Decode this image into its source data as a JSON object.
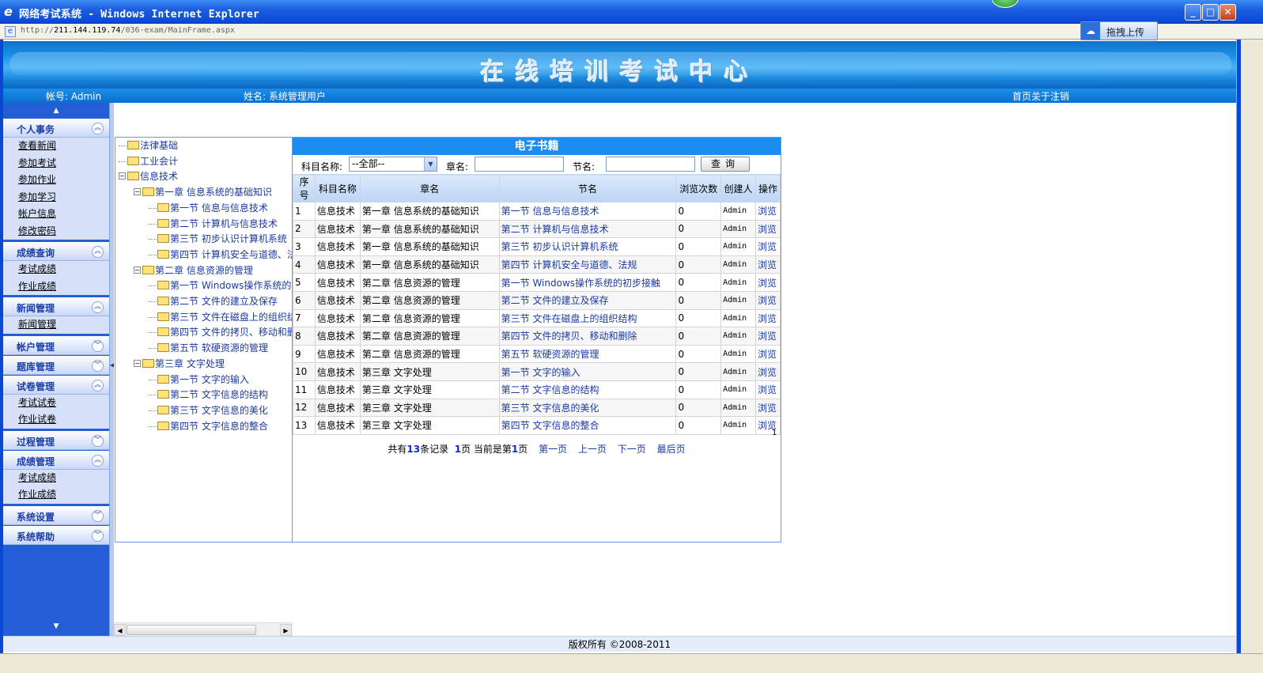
{
  "window": {
    "title": "网络考试系统 - Windows Internet Explorer",
    "url_prefix": "http://",
    "url_host": "211.144.119.74",
    "url_path": "/036-exam/MainFrame.aspx",
    "upload_button": "拖拽上传"
  },
  "header": {
    "site_title": "在线培训考试中心",
    "account": "帐号: Admin",
    "name": "姓名: 系统管理用户",
    "links": [
      "首页",
      "关于",
      "注销"
    ]
  },
  "sidebar": {
    "groups": [
      {
        "label": "个人事务",
        "expanded": true,
        "items": [
          "查看新闻",
          "参加考试",
          "参加作业",
          "参加学习",
          "帐户信息",
          "修改密码"
        ]
      },
      {
        "label": "成绩查询",
        "expanded": true,
        "items": [
          "考试成绩",
          "作业成绩"
        ]
      },
      {
        "label": "新闻管理",
        "expanded": true,
        "items": [
          "新闻管理"
        ]
      },
      {
        "label": "帐户管理",
        "expanded": false,
        "items": []
      },
      {
        "label": "题库管理",
        "expanded": false,
        "items": []
      },
      {
        "label": "试卷管理",
        "expanded": true,
        "items": [
          "考试试卷",
          "作业试卷"
        ]
      },
      {
        "label": "过程管理",
        "expanded": false,
        "items": []
      },
      {
        "label": "成绩管理",
        "expanded": true,
        "items": [
          "考试成绩",
          "作业成绩"
        ]
      },
      {
        "label": "系统设置",
        "expanded": false,
        "items": []
      },
      {
        "label": "系统帮助",
        "expanded": false,
        "items": []
      }
    ]
  },
  "tree": {
    "nodes": [
      {
        "label": "法律基础",
        "level": 0,
        "expanded": false
      },
      {
        "label": "工业会计",
        "level": 0,
        "expanded": false
      },
      {
        "label": "信息技术",
        "level": 0,
        "expanded": true
      },
      {
        "label": "第一章 信息系统的基础知识",
        "level": 1,
        "expanded": true
      },
      {
        "label": "第一节 信息与信息技术",
        "level": 2
      },
      {
        "label": "第二节 计算机与信息技术",
        "level": 2
      },
      {
        "label": "第三节 初步认识计算机系统",
        "level": 2
      },
      {
        "label": "第四节 计算机安全与道德、法规",
        "level": 2
      },
      {
        "label": "第二章 信息资源的管理",
        "level": 1,
        "expanded": true
      },
      {
        "label": "第一节 Windows操作系统的初步接触",
        "level": 2
      },
      {
        "label": "第二节 文件的建立及保存",
        "level": 2
      },
      {
        "label": "第三节 文件在磁盘上的组织结构",
        "level": 2
      },
      {
        "label": "第四节 文件的拷贝、移动和删除",
        "level": 2
      },
      {
        "label": "第五节 软硬资源的管理",
        "level": 2
      },
      {
        "label": "第三章 文字处理",
        "level": 1,
        "expanded": true
      },
      {
        "label": "第一节 文字的输入",
        "level": 2
      },
      {
        "label": "第二节 文字信息的结构",
        "level": 2
      },
      {
        "label": "第三节 文字信息的美化",
        "level": 2
      },
      {
        "label": "第四节 文字信息的整合",
        "level": 2
      }
    ]
  },
  "grid": {
    "title": "电子书籍",
    "search": {
      "subject_label": "科目名称:",
      "subject_value": "--全部--",
      "chapter_label": "章名:",
      "section_label": "节名:",
      "query_button": "查询"
    },
    "columns": [
      "序号",
      "科目名称",
      "章名",
      "节名",
      "浏览次数",
      "创建人",
      "操作"
    ],
    "rows": [
      [
        "1",
        "信息技术",
        "第一章 信息系统的基础知识",
        "第一节 信息与信息技术",
        "0",
        "Admin",
        "浏览"
      ],
      [
        "2",
        "信息技术",
        "第一章 信息系统的基础知识",
        "第二节 计算机与信息技术",
        "0",
        "Admin",
        "浏览"
      ],
      [
        "3",
        "信息技术",
        "第一章 信息系统的基础知识",
        "第三节 初步认识计算机系统",
        "0",
        "Admin",
        "浏览"
      ],
      [
        "4",
        "信息技术",
        "第一章 信息系统的基础知识",
        "第四节 计算机安全与道德、法规",
        "0",
        "Admin",
        "浏览"
      ],
      [
        "5",
        "信息技术",
        "第二章 信息资源的管理",
        "第一节 Windows操作系统的初步接触",
        "0",
        "Admin",
        "浏览"
      ],
      [
        "6",
        "信息技术",
        "第二章 信息资源的管理",
        "第二节 文件的建立及保存",
        "0",
        "Admin",
        "浏览"
      ],
      [
        "7",
        "信息技术",
        "第二章 信息资源的管理",
        "第三节 文件在磁盘上的组织结构",
        "0",
        "Admin",
        "浏览"
      ],
      [
        "8",
        "信息技术",
        "第二章 信息资源的管理",
        "第四节 文件的拷贝、移动和删除",
        "0",
        "Admin",
        "浏览"
      ],
      [
        "9",
        "信息技术",
        "第二章 信息资源的管理",
        "第五节 软硬资源的管理",
        "0",
        "Admin",
        "浏览"
      ],
      [
        "10",
        "信息技术",
        "第三章 文字处理",
        "第一节 文字的输入",
        "0",
        "Admin",
        "浏览"
      ],
      [
        "11",
        "信息技术",
        "第三章 文字处理",
        "第二节 文字信息的结构",
        "0",
        "Admin",
        "浏览"
      ],
      [
        "12",
        "信息技术",
        "第三章 文字处理",
        "第三节 文字信息的美化",
        "0",
        "Admin",
        "浏览"
      ],
      [
        "13",
        "信息技术",
        "第三章 文字处理",
        "第四节 文字信息的整合",
        "0",
        "Admin",
        "浏览"
      ]
    ],
    "pager": {
      "page_number": "1",
      "total_prefix": "共有",
      "total_records": "13",
      "total_suffix": "条记录",
      "page_count": "1",
      "page_count_suffix": "页 当前是第",
      "current_page": "1",
      "current_suffix": "页",
      "first": "第一页",
      "prev": "上一页",
      "next": "下一页",
      "last": "最后页"
    }
  },
  "footer": {
    "copyright": "版权所有 ©2008-2011"
  },
  "colors": {
    "accent": "#1d8cf0",
    "link": "#1a3aa0",
    "sidebar": "#235ed6",
    "titlebar": "#0a48d4"
  }
}
